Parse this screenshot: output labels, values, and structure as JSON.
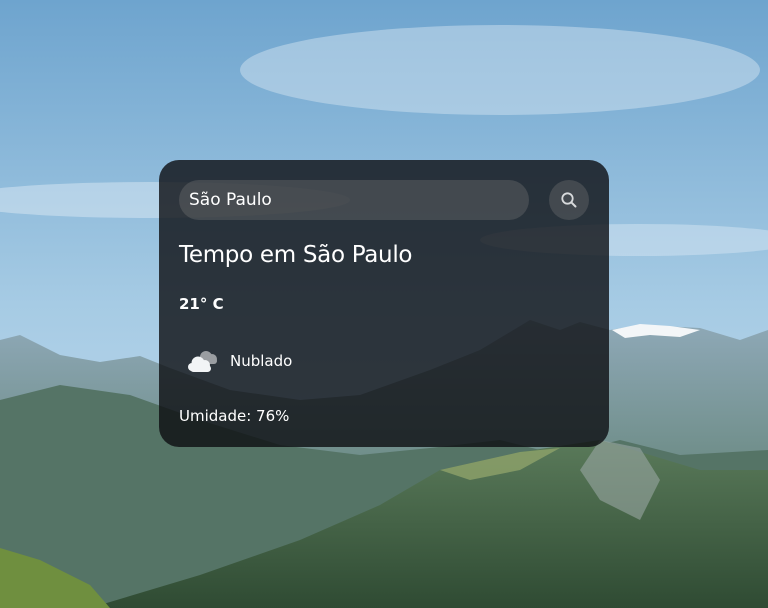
{
  "search": {
    "value": "São Paulo",
    "button_icon": "search-icon"
  },
  "weather": {
    "title": "Tempo em São Paulo",
    "temperature": "21° C",
    "icon": "cloudy-icon",
    "description": "Nublado",
    "humidity": "Umidade: 76%"
  },
  "colors": {
    "card_background": "#0c0e12",
    "text": "#ffffff",
    "input_background": "#7c7c7c"
  }
}
